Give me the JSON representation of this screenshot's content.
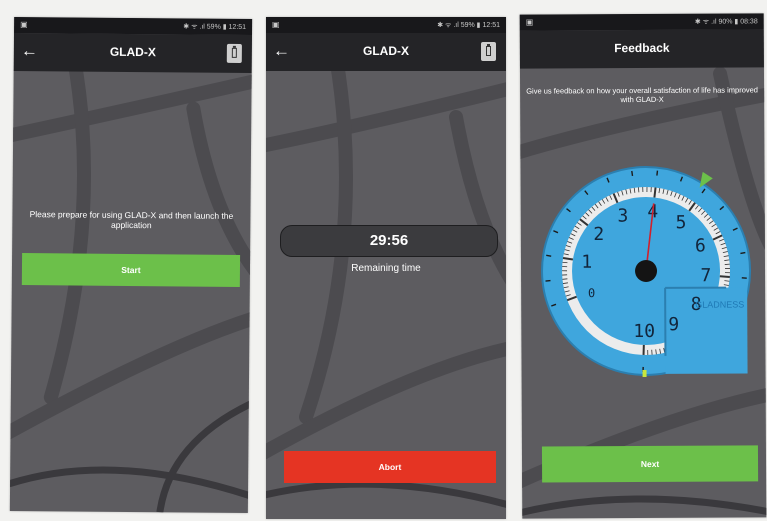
{
  "screens": [
    {
      "status": {
        "left_icon": "▣",
        "right": "✱ ᯤ .ıl 59% ▮ 12:51"
      },
      "app_title": "GLAD-X",
      "prompt": "Please prepare for using GLAD-X and then launch the application",
      "button_label": "Start"
    },
    {
      "status": {
        "left_icon": "▣",
        "right": "✱ ᯤ .ıl 59% ▮ 12:51"
      },
      "app_title": "GLAD-X",
      "timer_value": "29:56",
      "timer_label": "Remaining time",
      "button_label": "Abort"
    },
    {
      "status": {
        "left_icon": "▣",
        "right": "✱ ᯤ .ıl 90% ▮ 08:38"
      },
      "app_title": "Feedback",
      "description": "Give us feedback on how your overall satisfaction of life has improved with GLAD-X",
      "gauge": {
        "numbers": [
          "0",
          "1",
          "2",
          "3",
          "4",
          "5",
          "6",
          "7",
          "8",
          "9",
          "10"
        ],
        "brand": "GLADNESS",
        "value": 4
      },
      "button_label": "Next"
    }
  ],
  "colors": {
    "green": "#6cc04a",
    "red": "#e53423",
    "gauge_blue": "#3fa6dd",
    "background": "#5d5c60"
  },
  "icons": {
    "back": "arrow-left-icon",
    "battery": "battery-icon"
  }
}
